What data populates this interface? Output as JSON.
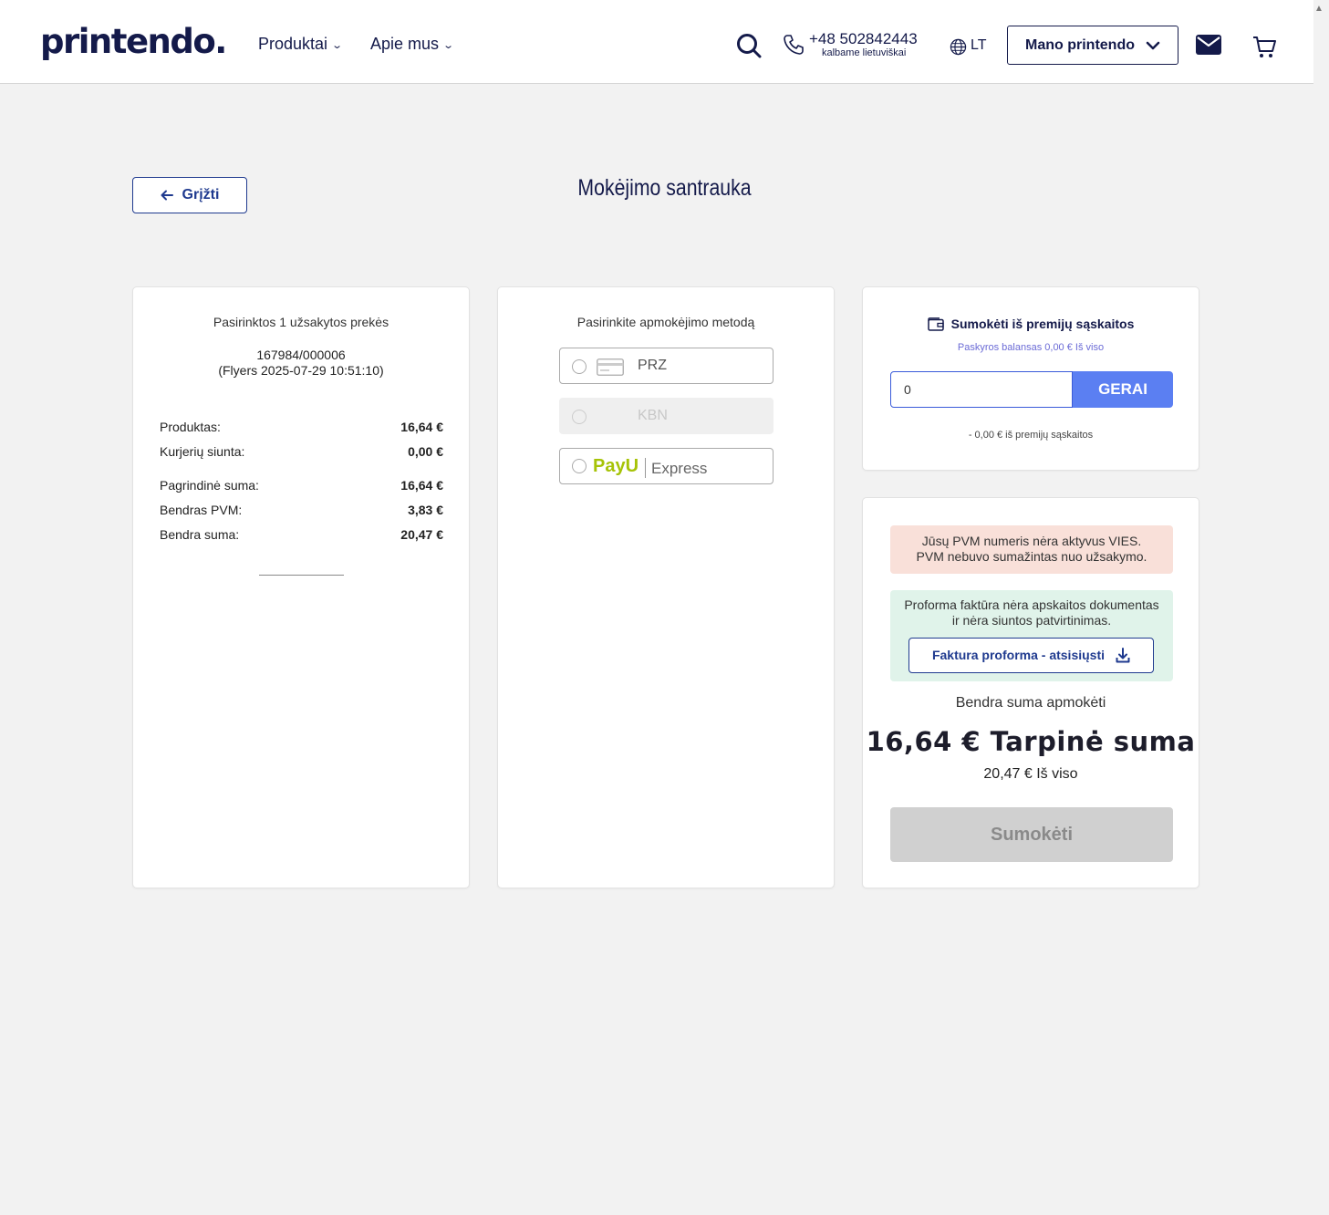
{
  "header": {
    "logo": "printendo.",
    "nav": [
      {
        "label": "Produktai"
      },
      {
        "label": "Apie mus"
      }
    ],
    "phone": "+48 502842443",
    "phone_sub": "kalbame lietuviškai",
    "lang": "LT",
    "account_label": "Mano printendo",
    "icons": [
      "search-icon",
      "phone-icon",
      "globe-icon",
      "chevron-down-icon",
      "mail-icon",
      "cart-icon"
    ]
  },
  "page": {
    "back_label": "Grįžti",
    "title": "Mokėjimo santrauka"
  },
  "order": {
    "title": "Pasirinktos 1 užsakytos prekės",
    "id_line1": "167984/000006",
    "id_line2": "(Flyers 2025-07-29 10:51:10)",
    "rows": [
      {
        "label": "Produktas:",
        "value": "16,64 €"
      },
      {
        "label": "Kurjerių siunta:",
        "value": "0,00 €"
      },
      {
        "label": "Pagrindinė suma:",
        "value": "16,64 €"
      },
      {
        "label": "Bendras PVM:",
        "value": "3,83 €"
      },
      {
        "label": "Bendra suma:",
        "value": "20,47 €"
      }
    ]
  },
  "payment": {
    "title": "Pasirinkite apmokėjimo metodą",
    "methods": [
      {
        "label": "PRZ",
        "disabled": false
      },
      {
        "label": "KBN",
        "disabled": true
      },
      {
        "brand": "PayU",
        "label": "Express",
        "disabled": false
      }
    ]
  },
  "bonus": {
    "title": "Sumokėti iš premijų sąskaitos",
    "balance": "Paskyros balansas 0,00 € Iš viso",
    "input_value": "0",
    "ok_label": "GERAI",
    "note": "- 0,00 € iš premijų sąskaitos"
  },
  "summary": {
    "vies_line1": "Jūsų PVM numeris nėra aktyvus VIES.",
    "vies_line2": "PVM nebuvo sumažintas nuo užsakymo.",
    "proforma_line1": "Proforma faktūra nėra apskaitos dokumentas",
    "proforma_line2": "ir nėra siuntos patvirtinimas.",
    "download_label": "Faktura proforma - atsisiųsti",
    "total_label": "Bendra suma apmokėti",
    "subtotal": "16,64 € Tarpinė suma",
    "total": "20,47 € Iš viso",
    "pay_label": "Sumokėti"
  },
  "colors": {
    "brand": "#141a4a",
    "accent": "#5b7ff2",
    "link": "#1f3a8f",
    "warning_bg": "#f9e0d9",
    "info_bg": "#e0f3ea",
    "payu_green": "#a6c307"
  }
}
